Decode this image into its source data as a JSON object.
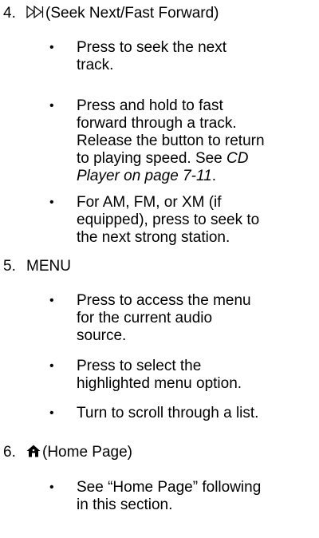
{
  "items": [
    {
      "number": "4.",
      "icon": "seek-next-icon",
      "title": "(Seek Next/Fast Forward)",
      "bullets": [
        {
          "lines": [
            "Press to seek the next",
            "track."
          ]
        },
        {
          "lines": [
            "Press and hold to fast",
            "forward through a track.",
            "Release the button to return",
            "to playing speed. See "
          ],
          "ref_line1": "CD",
          "ref_line2": "Player on page 7-11",
          "ref_tail": "."
        },
        {
          "lines": [
            "For AM, FM, or XM (if",
            "equipped), press to seek to",
            "the next strong station."
          ]
        }
      ]
    },
    {
      "number": "5.",
      "title": "MENU",
      "bullets": [
        {
          "lines": [
            "Press to access the menu",
            "for the current audio",
            "source."
          ]
        },
        {
          "lines": [
            "Press to select the",
            "highlighted menu option."
          ]
        },
        {
          "lines": [
            "Turn to scroll through a list."
          ]
        }
      ]
    },
    {
      "number": "6.",
      "icon": "home-icon",
      "title": "(Home Page)",
      "bullets": [
        {
          "lines": [
            "See “Home Page” following",
            "in this section."
          ]
        }
      ]
    }
  ],
  "bullet_char": "•"
}
